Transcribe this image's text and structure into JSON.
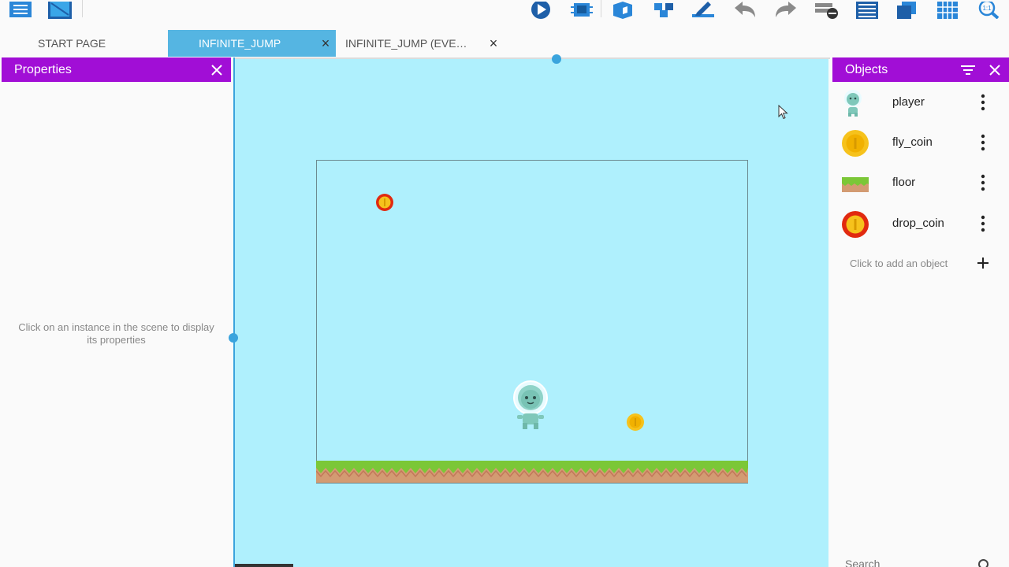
{
  "tabs": [
    {
      "label": "START PAGE",
      "active": false
    },
    {
      "label": "INFINITE_JUMP",
      "active": true
    },
    {
      "label": "INFINITE_JUMP (EVE…",
      "active": false
    }
  ],
  "properties": {
    "title": "Properties",
    "empty_line1": "Click on an instance in the scene to display",
    "empty_line2": "its properties"
  },
  "objects": {
    "title": "Objects",
    "items": [
      {
        "name": "player",
        "icon": "player-sprite-icon"
      },
      {
        "name": "fly_coin",
        "icon": "gold-coin-icon"
      },
      {
        "name": "floor",
        "icon": "grass-tile-icon"
      },
      {
        "name": "drop_coin",
        "icon": "red-coin-icon"
      }
    ],
    "add_label": "Click to add an object",
    "search_placeholder": "Search"
  },
  "colors": {
    "accent_purple": "#a10ed6",
    "tab_active": "#55b5e2",
    "scene_bg": "#aff0fd",
    "selection_blue": "#3aa4dd"
  }
}
